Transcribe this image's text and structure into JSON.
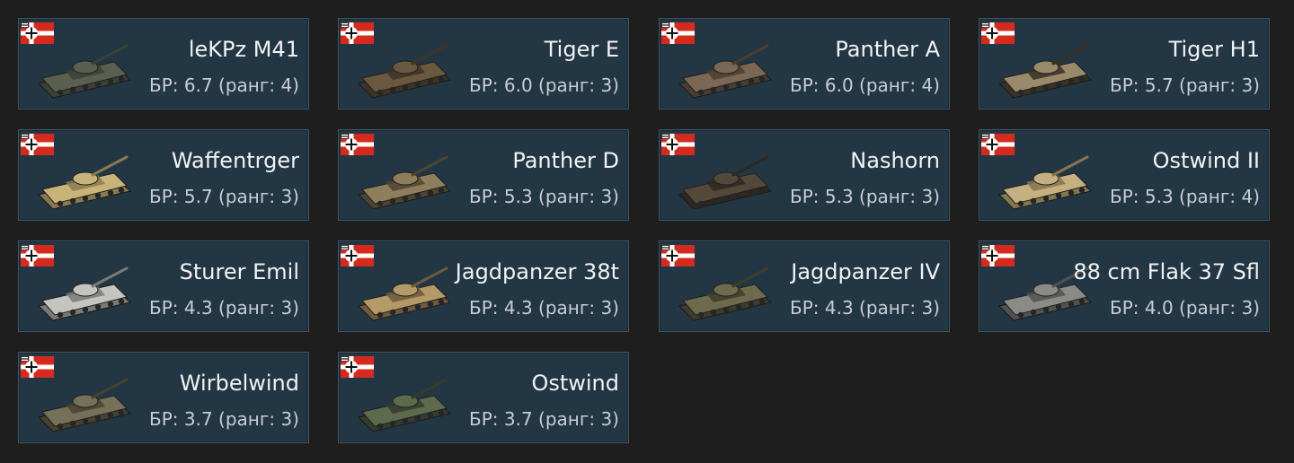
{
  "nation_flag_icon": "german-war-flag-icon",
  "vehicles": [
    {
      "name": "leKPz M41",
      "br": "БР: 6.7 (ранг: 4)",
      "body": "#5a5f50",
      "accent": "#3c4136"
    },
    {
      "name": "Tiger E",
      "br": "БР: 6.0 (ранг: 3)",
      "body": "#6a5840",
      "accent": "#3e3326"
    },
    {
      "name": "Panther A",
      "br": "БР: 6.0 (ранг: 4)",
      "body": "#7a6854",
      "accent": "#4a3e32"
    },
    {
      "name": "Tiger H1",
      "br": "БР: 5.7 (ранг: 3)",
      "body": "#9a8a6c",
      "accent": "#3a3024"
    },
    {
      "name": "Waffentrger",
      "br": "БР: 5.7 (ранг: 3)",
      "body": "#c8b478",
      "accent": "#8a7a50"
    },
    {
      "name": "Panther D",
      "br": "БР: 5.3 (ранг: 3)",
      "body": "#8e7e5c",
      "accent": "#4e4432"
    },
    {
      "name": "Nashorn",
      "br": "БР: 5.3 (ранг: 3)",
      "body": "#54483a",
      "accent": "#2e2820"
    },
    {
      "name": "Ostwind II",
      "br": "БР: 5.3 (ранг: 4)",
      "body": "#c4b080",
      "accent": "#86764e"
    },
    {
      "name": "Sturer Emil",
      "br": "БР: 4.3 (ранг: 3)",
      "body": "#c4c4c0",
      "accent": "#7a7a76"
    },
    {
      "name": "Jagdpanzer 38t",
      "br": "БР: 4.3 (ранг: 3)",
      "body": "#b49a68",
      "accent": "#6e5a3c"
    },
    {
      "name": "Jagdpanzer IV",
      "br": "БР: 4.3 (ранг: 3)",
      "body": "#6e6a4e",
      "accent": "#3e3c2c"
    },
    {
      "name": "88 cm Flak 37 Sfl",
      "br": "БР: 4.0 (ранг: 3)",
      "body": "#8a8a86",
      "accent": "#525250"
    },
    {
      "name": "Wirbelwind",
      "br": "БР: 3.7 (ранг: 3)",
      "body": "#76705a",
      "accent": "#46422e"
    },
    {
      "name": "Ostwind",
      "br": "БР: 3.7 (ранг: 3)",
      "body": "#5e6a4e",
      "accent": "#343c2c"
    }
  ]
}
